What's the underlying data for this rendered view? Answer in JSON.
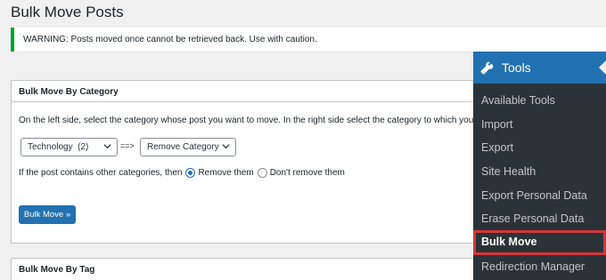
{
  "page": {
    "title": "Bulk Move Posts",
    "notice": "WARNING: Posts moved once cannot be retrieved back. Use with caution."
  },
  "category_box": {
    "heading": "Bulk Move By Category",
    "description": "On the left side, select the category whose post you want to move. In the right side select the category to which you want th",
    "from_select": "Technology  (2)",
    "arrow": "==>",
    "to_select": "Remove Category",
    "radio_prompt": "If the post contains other categories, then",
    "radio_options": [
      {
        "label": "Remove them",
        "checked": true
      },
      {
        "label": "Don't remove them",
        "checked": false
      }
    ],
    "button": "Bulk Move »"
  },
  "tag_box": {
    "heading": "Bulk Move By Tag"
  },
  "admin_menu": {
    "section": "Tools",
    "section_icon": "wrench-icon",
    "items": [
      {
        "label": "Available Tools"
      },
      {
        "label": "Import"
      },
      {
        "label": "Export"
      },
      {
        "label": "Site Health"
      },
      {
        "label": "Export Personal Data"
      },
      {
        "label": "Erase Personal Data"
      },
      {
        "label": "Bulk Move",
        "current": true
      },
      {
        "label": "Redirection Manager"
      }
    ],
    "colors": {
      "menu_bg": "#2c3338",
      "active_bg": "#2271b1",
      "highlight_border": "#d63638"
    }
  },
  "colors": {
    "primary": "#2271b1",
    "notice_border": "#00a32a",
    "background": "#f0f0f1"
  }
}
